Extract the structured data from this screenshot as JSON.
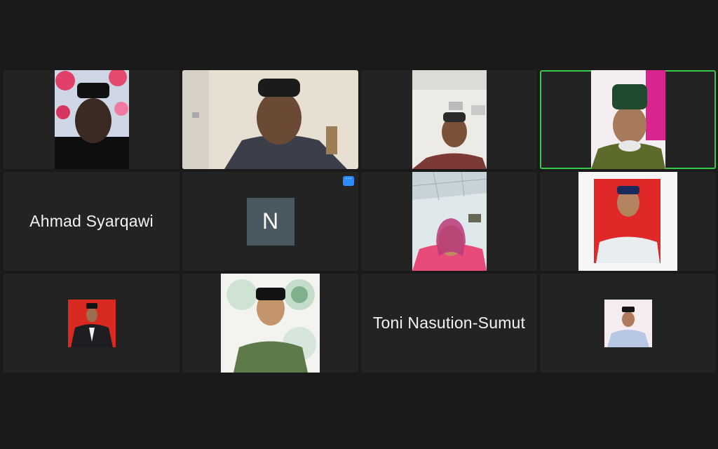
{
  "window": {
    "title": ""
  },
  "colors": {
    "background": "#1a1a1a",
    "tile": "#232323",
    "active_speaker_border": "#36c94a",
    "avatar_bg": "#4a5861",
    "more_button": "#2d8cff"
  },
  "participants": [
    {
      "id": "p1",
      "type": "video"
    },
    {
      "id": "p2",
      "type": "video"
    },
    {
      "id": "p3",
      "type": "video"
    },
    {
      "id": "p4",
      "type": "video",
      "active_speaker": true
    },
    {
      "id": "p5",
      "type": "name",
      "name": "Ahmad Syarqawi"
    },
    {
      "id": "p6",
      "type": "avatar",
      "initial": "N",
      "more_icon": "more-options-icon"
    },
    {
      "id": "p7",
      "type": "video"
    },
    {
      "id": "p8",
      "type": "video"
    },
    {
      "id": "p9",
      "type": "video"
    },
    {
      "id": "p10",
      "type": "video"
    },
    {
      "id": "p11",
      "type": "name",
      "name": "Toni Nasution-Sumut"
    },
    {
      "id": "p12",
      "type": "video"
    }
  ]
}
